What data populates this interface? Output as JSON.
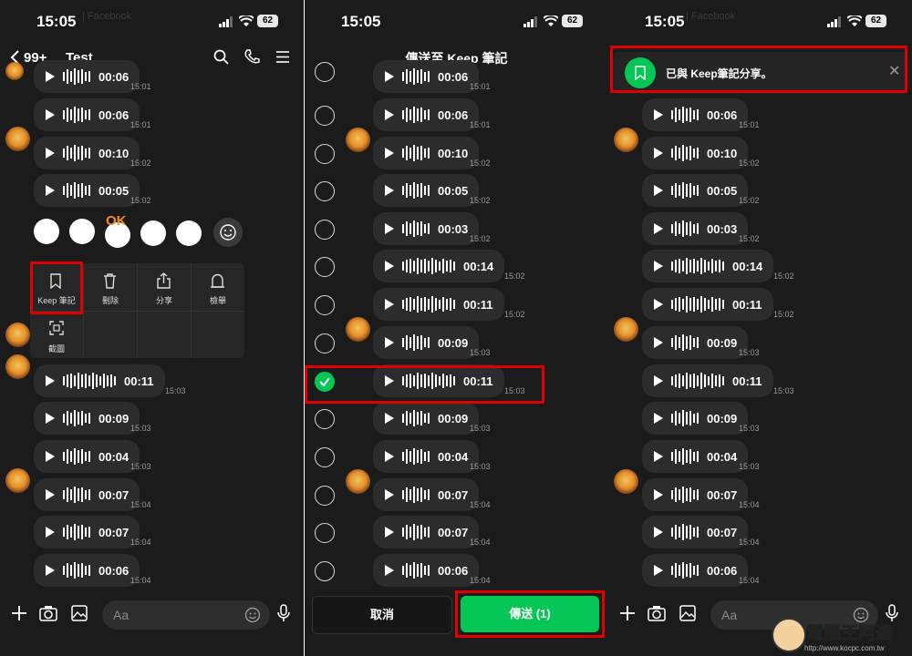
{
  "status_bar": {
    "time": "15:05",
    "battery": "62"
  },
  "panel1": {
    "header": {
      "back_count": "99+",
      "chat_name": "Test"
    },
    "ghost_text": "| Facebook",
    "messages": [
      {
        "duration": "00:06",
        "time": "15:01",
        "wave": "short"
      },
      {
        "duration": "00:06",
        "time": "15:01",
        "wave": "short"
      },
      {
        "duration": "00:10",
        "time": "15:02",
        "wave": "short",
        "avatar": true
      },
      {
        "duration": "00:05",
        "time": "15:02",
        "wave": "short"
      },
      {
        "duration": "00:11",
        "time": "15:03",
        "wave": "long",
        "avatar": true
      },
      {
        "duration": "00:09",
        "time": "15:03",
        "wave": "short"
      },
      {
        "duration": "00:04",
        "time": "15:03",
        "wave": "short"
      },
      {
        "duration": "00:07",
        "time": "15:04",
        "wave": "short",
        "avatar": true
      },
      {
        "duration": "00:07",
        "time": "15:04",
        "wave": "short"
      },
      {
        "duration": "00:06",
        "time": "15:04",
        "wave": "short"
      }
    ],
    "reaction_ok": "OK",
    "menu": {
      "keep": "Keep 筆記",
      "delete": "刪除",
      "share": "分享",
      "report": "檢舉",
      "screenshot": "截圖"
    },
    "input_placeholder": "Aa"
  },
  "panel2": {
    "title": "傳送至 Keep 筆記",
    "messages": [
      {
        "duration": "00:06",
        "time": "15:01",
        "wave": "short"
      },
      {
        "duration": "00:06",
        "time": "15:01",
        "wave": "short"
      },
      {
        "duration": "00:10",
        "time": "15:02",
        "wave": "short",
        "avatar": true
      },
      {
        "duration": "00:05",
        "time": "15:02",
        "wave": "short"
      },
      {
        "duration": "00:03",
        "time": "15:02",
        "wave": "short"
      },
      {
        "duration": "00:14",
        "time": "15:02",
        "wave": "long"
      },
      {
        "duration": "00:11",
        "time": "15:02",
        "wave": "long"
      },
      {
        "duration": "00:09",
        "time": "15:03",
        "wave": "short",
        "avatar": true
      },
      {
        "duration": "00:11",
        "time": "15:03",
        "wave": "long",
        "selected": true
      },
      {
        "duration": "00:09",
        "time": "15:03",
        "wave": "short"
      },
      {
        "duration": "00:04",
        "time": "15:03",
        "wave": "short"
      },
      {
        "duration": "00:07",
        "time": "15:04",
        "wave": "short",
        "avatar": true
      },
      {
        "duration": "00:07",
        "time": "15:04",
        "wave": "short"
      },
      {
        "duration": "00:06",
        "time": "15:04",
        "wave": "short"
      }
    ],
    "cancel": "取消",
    "send": "傳送 (1)"
  },
  "panel3": {
    "toast": "已與 Keep筆記分享。",
    "ghost_text": "| Facebook",
    "messages": [
      {
        "duration": "00:06",
        "time": "15:01",
        "wave": "short"
      },
      {
        "duration": "00:10",
        "time": "15:02",
        "wave": "short",
        "avatar": true
      },
      {
        "duration": "00:05",
        "time": "15:02",
        "wave": "short"
      },
      {
        "duration": "00:03",
        "time": "15:02",
        "wave": "short"
      },
      {
        "duration": "00:14",
        "time": "15:02",
        "wave": "long"
      },
      {
        "duration": "00:11",
        "time": "15:02",
        "wave": "long"
      },
      {
        "duration": "00:09",
        "time": "15:03",
        "wave": "short",
        "avatar": true
      },
      {
        "duration": "00:11",
        "time": "15:03",
        "wave": "long"
      },
      {
        "duration": "00:09",
        "time": "15:03",
        "wave": "short"
      },
      {
        "duration": "00:04",
        "time": "15:03",
        "wave": "short"
      },
      {
        "duration": "00:07",
        "time": "15:04",
        "wave": "short",
        "avatar": true
      },
      {
        "duration": "00:07",
        "time": "15:04",
        "wave": "short"
      },
      {
        "duration": "00:06",
        "time": "15:04",
        "wave": "short"
      }
    ],
    "input_placeholder": "Aa"
  },
  "watermark": {
    "name": "電腦王阿達",
    "url": "http://www.kocpc.com.tw"
  },
  "colors": {
    "accent": "#06c755",
    "highlight": "#e00000",
    "bubble": "#2c2c2c",
    "background": "#1b1b1b"
  }
}
